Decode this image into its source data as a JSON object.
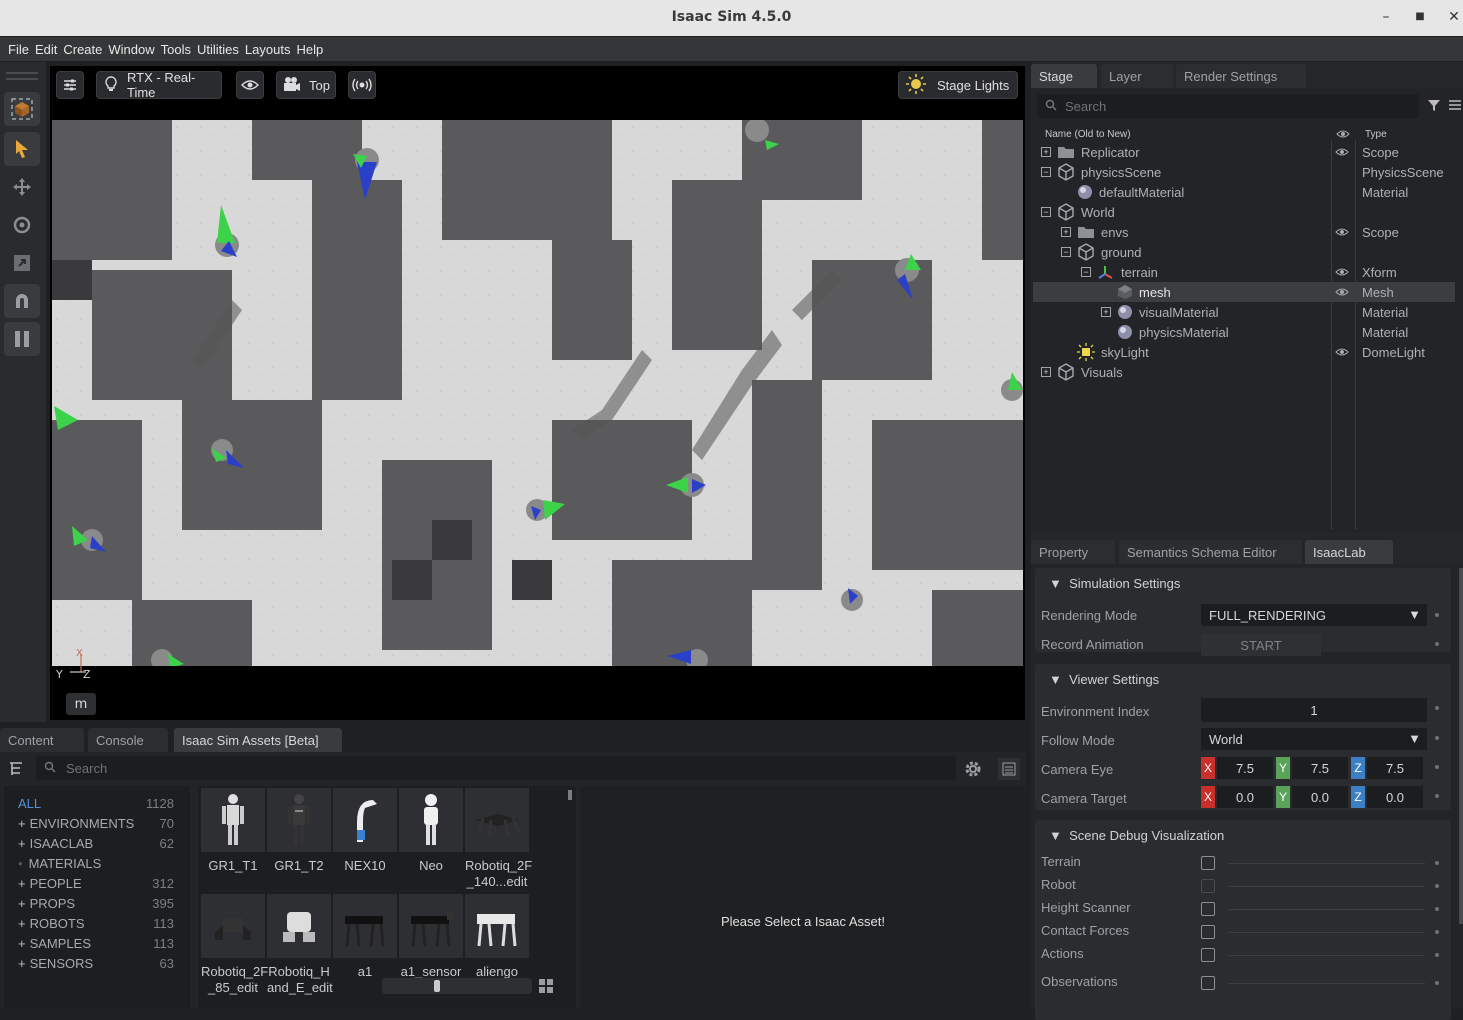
{
  "app": {
    "title": "Isaac Sim 4.5.0"
  },
  "menu": [
    "File",
    "Edit",
    "Create",
    "Window",
    "Tools",
    "Utilities",
    "Layouts",
    "Help"
  ],
  "viewport": {
    "render_mode": "RTX - Real-Time",
    "camera": "Top",
    "lights": "Stage Lights",
    "axis_y": "Y",
    "axis_z": "Z",
    "axis_x": "X",
    "units": "m"
  },
  "stage": {
    "tabs": [
      "Stage",
      "Layer",
      "Render Settings"
    ],
    "search_placeholder": "Search",
    "col_name": "Name (Old to New)",
    "col_type": "Type",
    "rows": [
      {
        "name": "Replicator",
        "type": "Scope",
        "eye": true
      },
      {
        "name": "physicsScene",
        "type": "PhysicsScene",
        "eye": false
      },
      {
        "name": "defaultMaterial",
        "type": "Material",
        "eye": false
      },
      {
        "name": "World",
        "type": "",
        "eye": false
      },
      {
        "name": "envs",
        "type": "Scope",
        "eye": true
      },
      {
        "name": "ground",
        "type": "",
        "eye": false
      },
      {
        "name": "terrain",
        "type": "Xform",
        "eye": true
      },
      {
        "name": "mesh",
        "type": "Mesh",
        "eye": true
      },
      {
        "name": "visualMaterial",
        "type": "Material",
        "eye": false
      },
      {
        "name": "physicsMaterial",
        "type": "Material",
        "eye": false
      },
      {
        "name": "skyLight",
        "type": "DomeLight",
        "eye": true
      },
      {
        "name": "Visuals",
        "type": "",
        "eye": false
      }
    ]
  },
  "props": {
    "tabs": [
      "Property",
      "Semantics Schema Editor",
      "IsaacLab"
    ],
    "sim_header": "Simulation Settings",
    "rendering_mode_label": "Rendering Mode",
    "rendering_mode_value": "FULL_RENDERING",
    "record_label": "Record Animation",
    "record_button": "START",
    "viewer_header": "Viewer Settings",
    "env_index_label": "Environment Index",
    "env_index_value": "1",
    "follow_label": "Follow Mode",
    "follow_value": "World",
    "eye_label": "Camera Eye",
    "target_label": "Camera Target",
    "x": "X",
    "y": "Y",
    "z": "Z",
    "eye": [
      "7.5",
      "7.5",
      "7.5"
    ],
    "target": [
      "0.0",
      "0.0",
      "0.0"
    ],
    "debug_header": "Scene Debug Visualization",
    "debug_items": [
      "Terrain",
      "Robot",
      "Height Scanner",
      "Contact Forces",
      "Actions",
      "Observations"
    ]
  },
  "bottom": {
    "tabs": [
      "Content",
      "Console",
      "Isaac Sim Assets [Beta]"
    ],
    "search_placeholder": "Search",
    "categories": [
      {
        "name": "ALL",
        "count": "1128"
      },
      {
        "name": "ENVIRONMENTS",
        "count": "70"
      },
      {
        "name": "ISAACLAB",
        "count": "62"
      },
      {
        "name": "MATERIALS",
        "count": ""
      },
      {
        "name": "PEOPLE",
        "count": "312"
      },
      {
        "name": "PROPS",
        "count": "395"
      },
      {
        "name": "ROBOTS",
        "count": "113"
      },
      {
        "name": "SAMPLES",
        "count": "113"
      },
      {
        "name": "SENSORS",
        "count": "63"
      }
    ],
    "assets_row1": [
      "GR1_T1",
      "GR1_T2",
      "NEX10",
      "Neo",
      "Robotiq_2F _140...edit"
    ],
    "assets_row2": [
      "Robotiq_2F _85_edit",
      "Robotiq_H and_E_edit",
      "a1",
      "a1_sensor",
      "aliengo"
    ],
    "placeholder_msg": "Please Select a Isaac Asset!"
  },
  "colors": {
    "x": "#c9302c",
    "y": "#5aa35a",
    "z": "#3d7fc4",
    "accent": "#5b8fd6"
  }
}
